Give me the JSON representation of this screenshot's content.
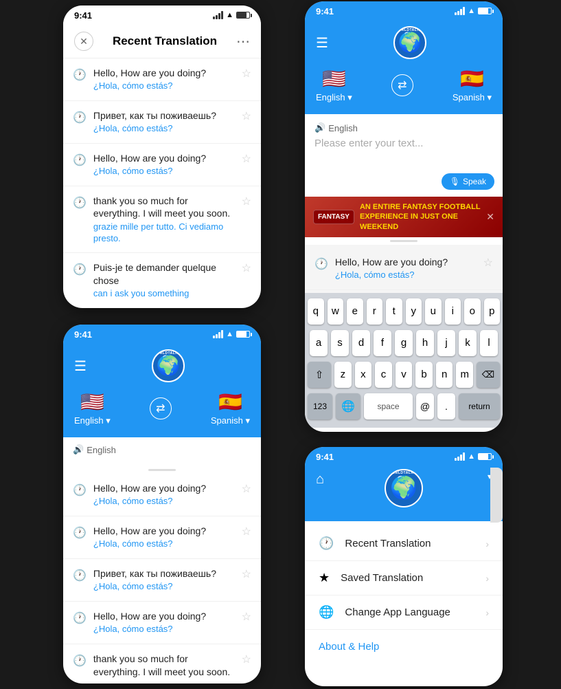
{
  "phone1": {
    "statusTime": "9:41",
    "title": "Recent Translation",
    "items": [
      {
        "original": "Hello, How are you doing?",
        "translated": "¿Hola, cómo estás?"
      },
      {
        "original": "Привет, как ты поживаешь?",
        "translated": "¿Hola, cómo estás?"
      },
      {
        "original": "Hello, How are you doing?",
        "translated": "¿Hola, cómo estás?"
      },
      {
        "original": "thank you so much for everything. I will meet you soon.",
        "translated": "grazie mille per tutto. Ci vediamo presto."
      },
      {
        "original": "Puis-je te demander quelque chose",
        "translated": "can i ask you something"
      }
    ]
  },
  "phone2": {
    "statusTime": "9:41",
    "logoText": "WORLDTALKS?",
    "langFrom": "English",
    "langTo": "Spanish",
    "inputLangLabel": "English",
    "items": [
      {
        "original": "Hello, How are you doing?",
        "translated": "¿Hola, cómo estás?"
      },
      {
        "original": "Hello, How are you doing?",
        "translated": "¿Hola, cómo estás?"
      },
      {
        "original": "Привет, как ты поживаешь?",
        "translated": "¿Hola, cómo estás?"
      },
      {
        "original": "Hello, How are you doing?",
        "translated": "¿Hola, cómo estás?"
      },
      {
        "original": "thank you so much for everything. I will meet you soon.",
        "translated": ""
      }
    ]
  },
  "phone3": {
    "statusTime": "9:41",
    "logoText": "WORLDTALKS?",
    "langFrom": "English",
    "langTo": "Spanish",
    "inputLangLabel": "English",
    "inputPlaceholder": "Please enter your text...",
    "speakLabel": "Speak",
    "adText": "AN ENTIRE FANTASY ",
    "adHighlight": "FOOTBALL EXPERIENCE",
    "adSuffix": " IN JUST ONE WEEKEND",
    "adLogoText": "FANTASY",
    "recentItem": {
      "original": "Hello, How are you doing?",
      "translated": "¿Hola, cómo estás?"
    },
    "keyboard": {
      "row1": [
        "q",
        "w",
        "e",
        "r",
        "t",
        "y",
        "u",
        "i",
        "o",
        "p"
      ],
      "row2": [
        "a",
        "s",
        "d",
        "f",
        "g",
        "h",
        "j",
        "k",
        "l"
      ],
      "row3": [
        "z",
        "x",
        "c",
        "v",
        "b",
        "n",
        "m"
      ]
    }
  },
  "phone4": {
    "statusTime": "9:41",
    "logoText": "WORLDTALKS?",
    "menuItems": [
      {
        "icon": "clock",
        "label": "Recent Translation"
      },
      {
        "icon": "star",
        "label": "Saved Translation"
      },
      {
        "icon": "globe",
        "label": "Change App Language"
      }
    ],
    "aboutHelp": "About & Help"
  }
}
